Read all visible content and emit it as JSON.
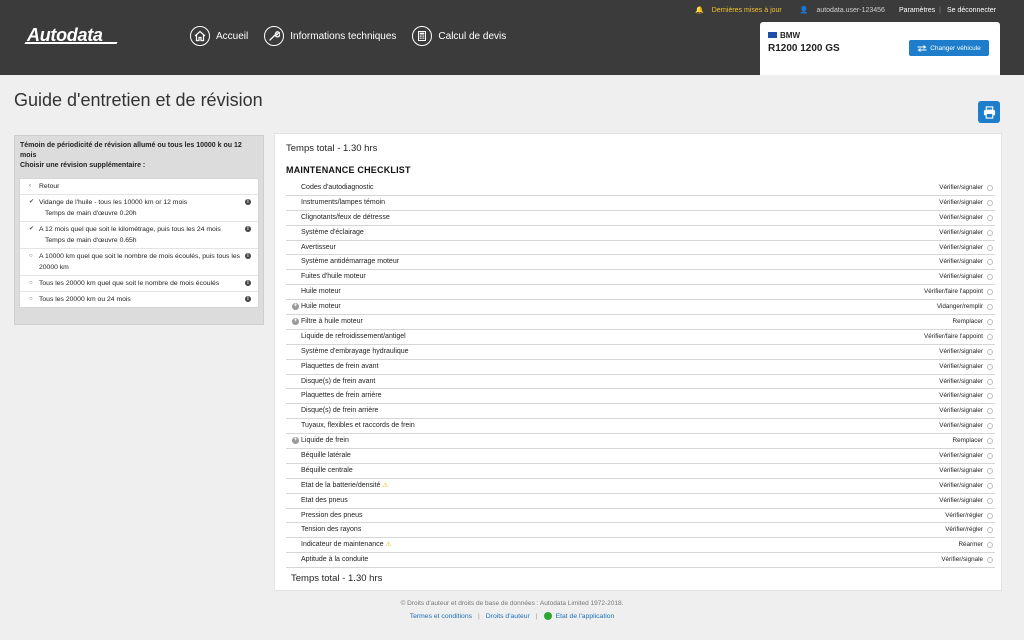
{
  "header": {
    "logo_text": "Autodata",
    "utility": {
      "updates_label": "Dernières mises à jour",
      "user_label": "autodata.user-123456",
      "settings_label": "Paramètres",
      "logout_label": "Se déconnecter"
    },
    "nav": [
      {
        "label": "Accueil",
        "icon": "home-icon"
      },
      {
        "label": "Informations techniques",
        "icon": "wrench-icon"
      },
      {
        "label": "Calcul de devis",
        "icon": "calculator-icon"
      }
    ],
    "vehicle": {
      "make": "BMW",
      "model": "R1200 1200 GS",
      "change_label": "Changer véhicule"
    }
  },
  "page": {
    "title": "Guide d'entretien et de révision"
  },
  "left_panel": {
    "heading_1": "Témoin de périodicité de révision allumé ou tous les 10000 k ou 12 mois",
    "heading_2": "Choisir une révision supplémentaire :",
    "back_label": "Retour",
    "options": [
      {
        "label": "Vidange de l'huile - tous les 10000 km or 12 mois",
        "sub": "Temps de main d'œuvre 0.20h",
        "checked": true
      },
      {
        "label": "A 12 mois quel que soit le kilométrage, puis tous les 24 mois",
        "sub": "Temps de main d'œuvre 0.65h",
        "checked": true
      },
      {
        "label": "A 10000 km quel que soit le nombre de mois écoulés, puis tous les 20000 km",
        "sub": "",
        "checked": false
      },
      {
        "label": "Tous les 20000 km quel que soit le nombre de mois écoulés",
        "sub": "",
        "checked": false
      },
      {
        "label": "Tous les 20000 km ou 24 mois",
        "sub": "",
        "checked": false
      }
    ]
  },
  "right_panel": {
    "total_top": "Temps total - 1.30 hrs",
    "section_title": "MAINTENANCE CHECKLIST",
    "total_bottom": "Temps total - 1.30 hrs",
    "items": [
      {
        "label": "Codes d'autodiagnostic",
        "action": "Vérifier/signaler",
        "expand": false,
        "warn": false
      },
      {
        "label": "Instruments/lampes témoin",
        "action": "Vérifier/signaler",
        "expand": false,
        "warn": false
      },
      {
        "label": "Clignotants/feux de détresse",
        "action": "Vérifier/signaler",
        "expand": false,
        "warn": false
      },
      {
        "label": "Système d'éclairage",
        "action": "Vérifier/signaler",
        "expand": false,
        "warn": false
      },
      {
        "label": "Avertisseur",
        "action": "Vérifier/signaler",
        "expand": false,
        "warn": false
      },
      {
        "label": "Système antidémarrage moteur",
        "action": "Vérifier/signaler",
        "expand": false,
        "warn": false
      },
      {
        "label": "Fuites d'huile moteur",
        "action": "Vérifier/signaler",
        "expand": false,
        "warn": false
      },
      {
        "label": "Huile moteur",
        "action": "Vérifier/faire l'appoint",
        "expand": false,
        "warn": false
      },
      {
        "label": "Huile moteur",
        "action": "Vidanger/remplir",
        "expand": true,
        "warn": false
      },
      {
        "label": "Filtre à huile moteur",
        "action": "Remplacer",
        "expand": true,
        "warn": false
      },
      {
        "label": "Liquide de refroidissement/antigel",
        "action": "Vérifier/faire l'appoint",
        "expand": false,
        "warn": false
      },
      {
        "label": "Système d'embrayage hydraulique",
        "action": "Vérifier/signaler",
        "expand": false,
        "warn": false
      },
      {
        "label": "Plaquettes de frein avant",
        "action": "Vérifier/signaler",
        "expand": false,
        "warn": false
      },
      {
        "label": "Disque(s) de frein avant",
        "action": "Vérifier/signaler",
        "expand": false,
        "warn": false
      },
      {
        "label": "Plaquettes de frein arrière",
        "action": "Vérifier/signaler",
        "expand": false,
        "warn": false
      },
      {
        "label": "Disque(s) de frein arrière",
        "action": "Vérifier/signaler",
        "expand": false,
        "warn": false
      },
      {
        "label": "Tuyaux, flexibles et raccords de frein",
        "action": "Vérifier/signaler",
        "expand": false,
        "warn": false
      },
      {
        "label": "Liquide de frein",
        "action": "Remplacer",
        "expand": true,
        "warn": false
      },
      {
        "label": "Béquille latérale",
        "action": "Vérifier/signaler",
        "expand": false,
        "warn": false
      },
      {
        "label": "Béquille centrale",
        "action": "Vérifier/signaler",
        "expand": false,
        "warn": false
      },
      {
        "label": "Etat de la batterie/densité",
        "action": "Vérifier/signaler",
        "expand": false,
        "warn": true
      },
      {
        "label": "Etat des pneus",
        "action": "Vérifier/signaler",
        "expand": false,
        "warn": false
      },
      {
        "label": "Pression des pneus",
        "action": "Vérifier/régler",
        "expand": false,
        "warn": false
      },
      {
        "label": "Tension des rayons",
        "action": "Vérifier/régler",
        "expand": false,
        "warn": false
      },
      {
        "label": "Indicateur de maintenance",
        "action": "Réarmer",
        "expand": false,
        "warn": true
      },
      {
        "label": "Aptitude à la conduite",
        "action": "Vérifier/signale",
        "expand": false,
        "warn": false
      }
    ]
  },
  "footer": {
    "copyright": "© Droits d'auteur et droits de base de données : Autodata Limited 1972-2018.",
    "terms_label": "Termes et conditions",
    "rights_label": "Droits d'auteur",
    "status_label": "Etat de l'application"
  },
  "colors": {
    "header_bg": "#3b3b3b",
    "accent_blue": "#1e7ecb",
    "updates_yellow": "#f2c12e",
    "status_green": "#2ea633"
  }
}
